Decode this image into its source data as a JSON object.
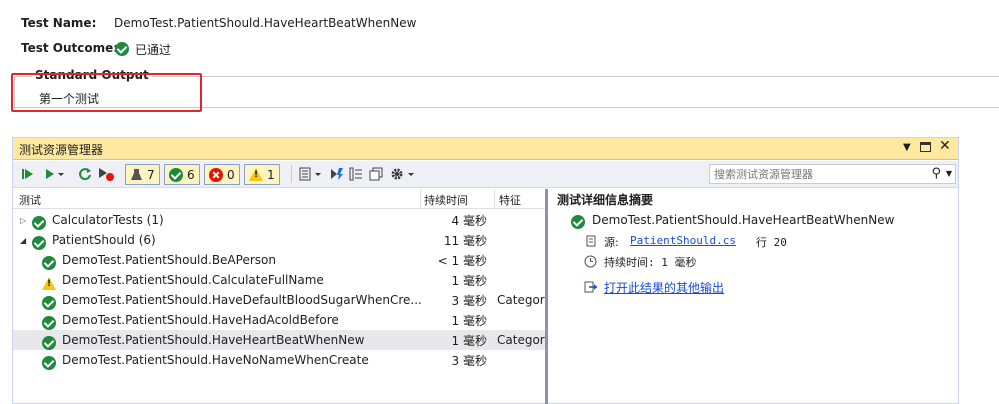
{
  "details": {
    "test_name_label": "Test Name:",
    "test_name_value": "DemoTest.PatientShould.HaveHeartBeatWhenNew",
    "test_outcome_label": "Test Outcome:",
    "test_outcome_value": "已通过",
    "stdout_legend": "Standard Output",
    "stdout_text": "第一个测试"
  },
  "explorer": {
    "title": "测试资源管理器",
    "counts": {
      "total": "7",
      "passed": "6",
      "failed": "0",
      "skipped": "1"
    },
    "search_placeholder": "搜索测试资源管理器",
    "columns": {
      "test": "测试",
      "duration": "持续时间",
      "traits": "特征"
    },
    "rows": [
      {
        "name": "CalculatorTests (1)",
        "duration": "4 毫秒",
        "trait": "",
        "status": "passed"
      },
      {
        "name": "PatientShould (6)",
        "duration": "11 毫秒",
        "trait": "",
        "status": "passed"
      },
      {
        "name": "DemoTest.PatientShould.BeAPerson",
        "duration": "< 1 毫秒",
        "trait": "",
        "status": "passed"
      },
      {
        "name": "DemoTest.PatientShould.CalculateFullName",
        "duration": "1 毫秒",
        "trait": "",
        "status": "skipped"
      },
      {
        "name": "DemoTest.PatientShould.HaveDefaultBloodSugarWhenCre...",
        "duration": "3 毫秒",
        "trait": "Categor",
        "status": "passed"
      },
      {
        "name": "DemoTest.PatientShould.HaveHadAcoldBefore",
        "duration": "1 毫秒",
        "trait": "",
        "status": "passed"
      },
      {
        "name": "DemoTest.PatientShould.HaveHeartBeatWhenNew",
        "duration": "1 毫秒",
        "trait": "Categor",
        "status": "passed"
      },
      {
        "name": "DemoTest.PatientShould.HaveNoNameWhenCreate",
        "duration": "3 毫秒",
        "trait": "",
        "status": "passed"
      }
    ],
    "summary": {
      "heading": "测试详细信息摘要",
      "test_name": "DemoTest.PatientShould.HaveHeartBeatWhenNew",
      "source_label": "源:",
      "source_file": "PatientShould.cs",
      "source_line": "行 20",
      "duration": "持续时间: 1 毫秒",
      "open_output": "打开此结果的其他输出"
    }
  },
  "colors": {
    "pass": "#1e8a3c",
    "fail": "#e51400",
    "warn": "#f2c811",
    "title_bg": "#ffe9a0",
    "link": "#1a4bd6"
  }
}
